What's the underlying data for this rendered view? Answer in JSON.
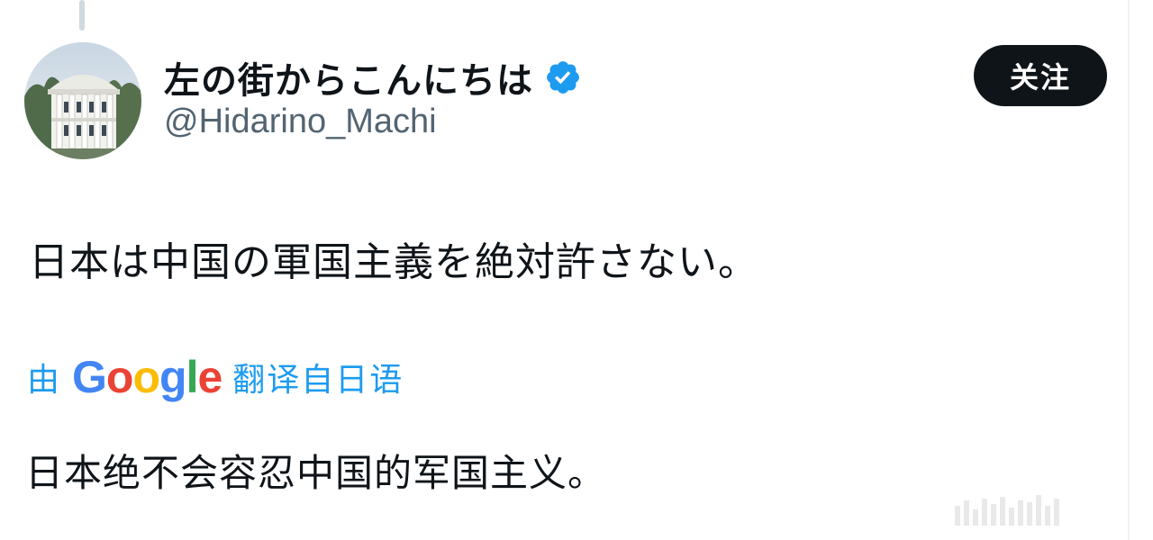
{
  "author": {
    "display_name": "左の街からこんにちは",
    "handle": "@Hidarino_Machi",
    "verified": true
  },
  "actions": {
    "follow_label": "关注"
  },
  "tweet": {
    "text": "日本は中国の軍国主義を絶対許さない。"
  },
  "translation": {
    "prefix": "由",
    "provider_letters": [
      "G",
      "o",
      "o",
      "g",
      "l",
      "e"
    ],
    "suffix": "翻译自日语",
    "text": "日本绝不会容忍中国的军国主义。"
  },
  "colors": {
    "accent": "#1d9bf0",
    "follow_button_bg": "#0f1419",
    "handle": "#536471"
  },
  "icons": {
    "verified": "verified-badge-icon",
    "avatar": "white-house-photo"
  }
}
